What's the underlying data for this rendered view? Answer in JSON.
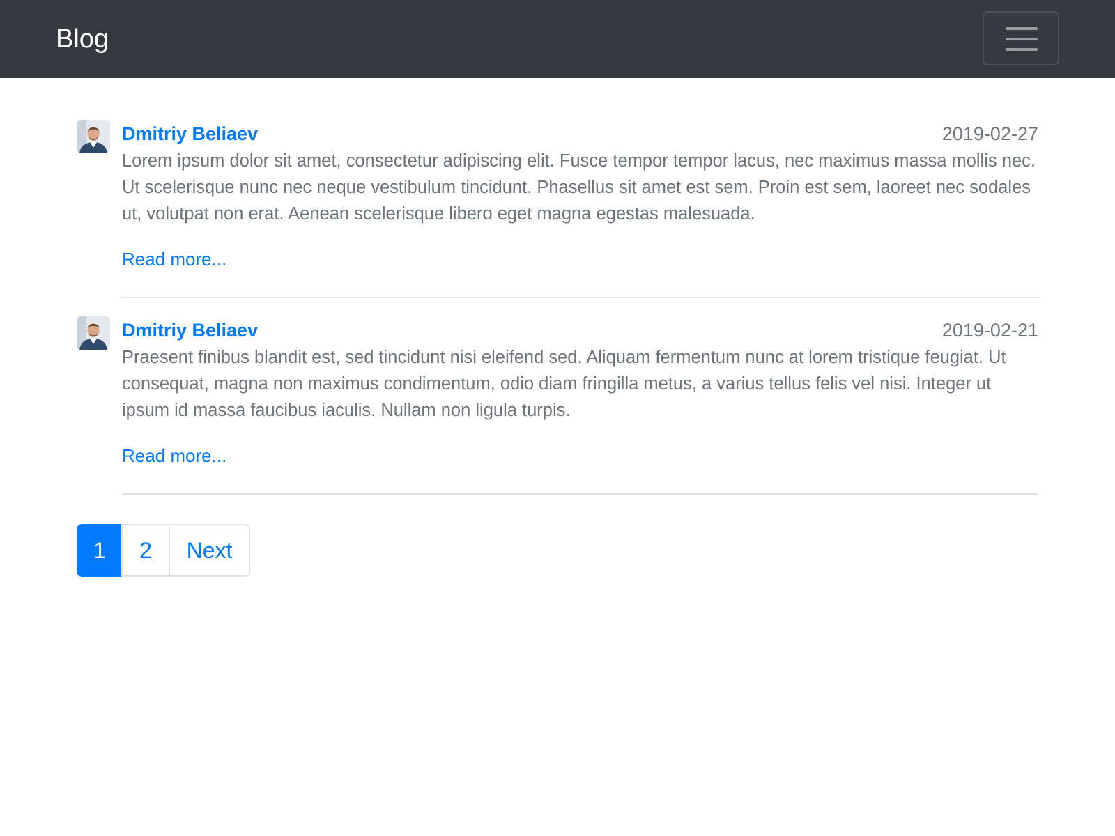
{
  "navbar": {
    "brand": "Blog",
    "toggle_icon": "hamburger-menu-icon",
    "background": "#343a40"
  },
  "posts": [
    {
      "author": "Dmitriy Beliaev",
      "date": "2019-02-27",
      "excerpt": "Lorem ipsum dolor sit amet, consectetur adipiscing elit. Fusce tempor tempor lacus, nec maximus massa mollis nec. Ut scelerisque nunc nec neque vestibulum tincidunt. Phasellus sit amet est sem. Proin est sem, laoreet nec sodales ut, volutpat non erat. Aenean scelerisque libero eget magna egestas malesuada.",
      "read_more": "Read more..."
    },
    {
      "author": "Dmitriy Beliaev",
      "date": "2019-02-21",
      "excerpt": "Praesent finibus blandit est, sed tincidunt nisi eleifend sed. Aliquam fermentum nunc at lorem tristique feugiat. Ut consequat, magna non maximus condimentum, odio diam fringilla metus, a varius tellus felis vel nisi. Integer ut ipsum id massa faucibus iaculis. Nullam non ligula turpis.",
      "read_more": "Read more..."
    }
  ],
  "pagination": {
    "pages": [
      "1",
      "2"
    ],
    "active_page": "1",
    "next_label": "Next"
  },
  "colors": {
    "accent": "#007bff",
    "muted_text": "#6c757d",
    "divider": "#dee2e6"
  }
}
